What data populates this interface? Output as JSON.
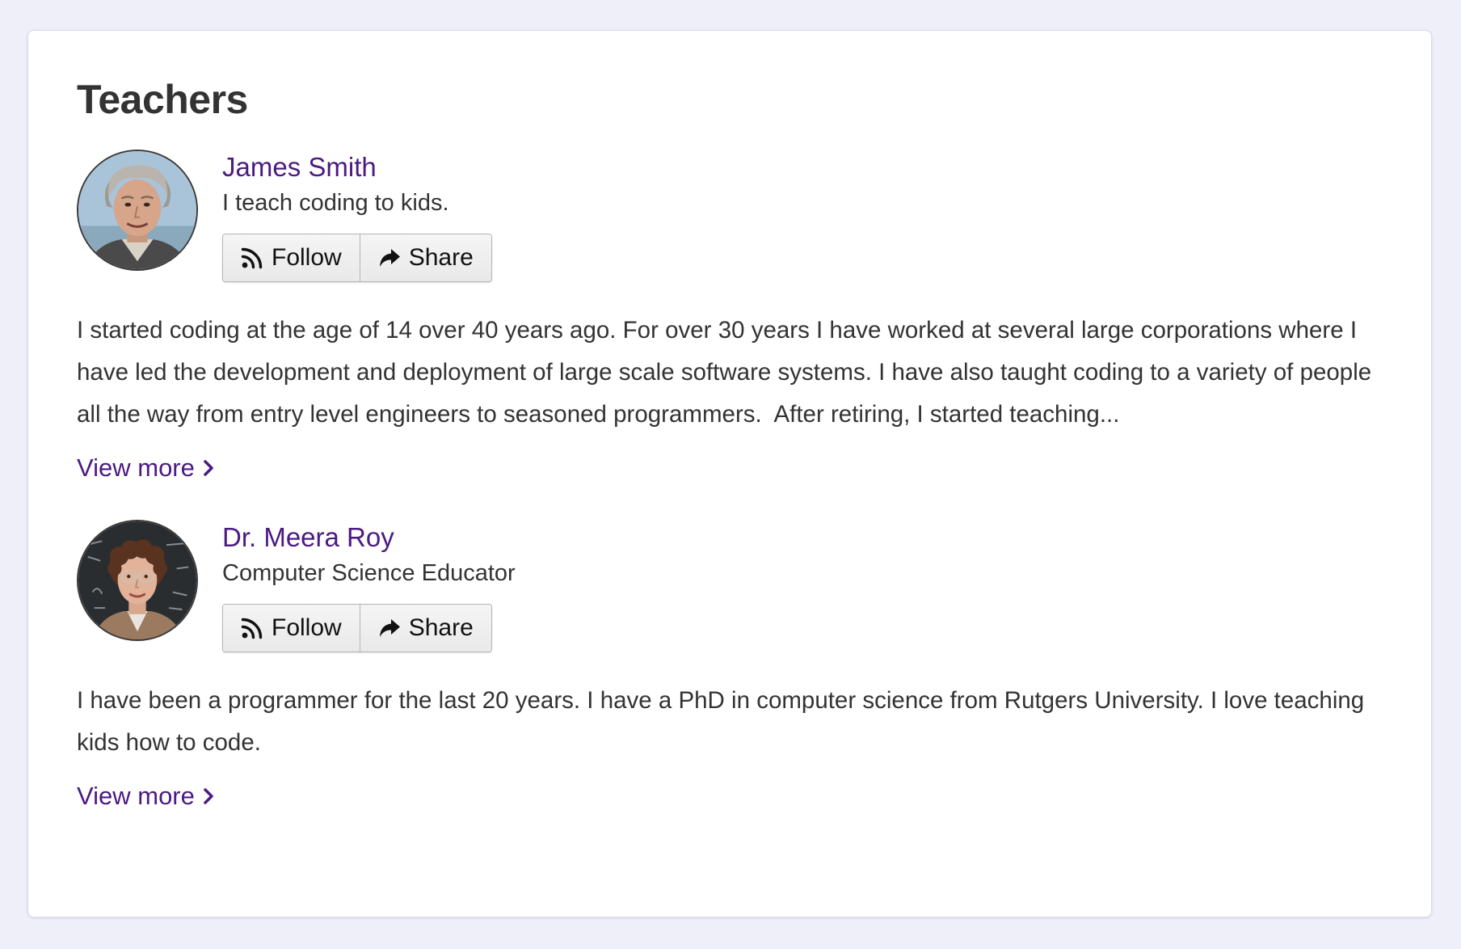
{
  "page": {
    "title": "Teachers"
  },
  "colors": {
    "background": "#efeff9",
    "card": "#ffffff",
    "link": "#4b1a82",
    "text": "#333333"
  },
  "teachers": [
    {
      "name": "James Smith",
      "tagline": "I teach coding to kids.",
      "follow_label": "Follow",
      "share_label": "Share",
      "bio": "I started coding at the age of 14 over 40 years ago. For over 30 years I have worked at several large corporations where I have led the development and deployment of large scale software systems. I have also taught coding to a variety of people all the way from entry level engineers to seasoned programmers.  After retiring, I started teaching...",
      "view_more_label": "View more",
      "avatar_icon": "avatar-photo-icon"
    },
    {
      "name": "Dr. Meera Roy",
      "tagline": "Computer Science Educator",
      "follow_label": "Follow",
      "share_label": "Share",
      "bio": "I have been a programmer for the last 20 years. I have a PhD in computer science from Rutgers University. I love teaching kids how to code.",
      "view_more_label": "View more",
      "avatar_icon": "avatar-photo-icon"
    }
  ]
}
